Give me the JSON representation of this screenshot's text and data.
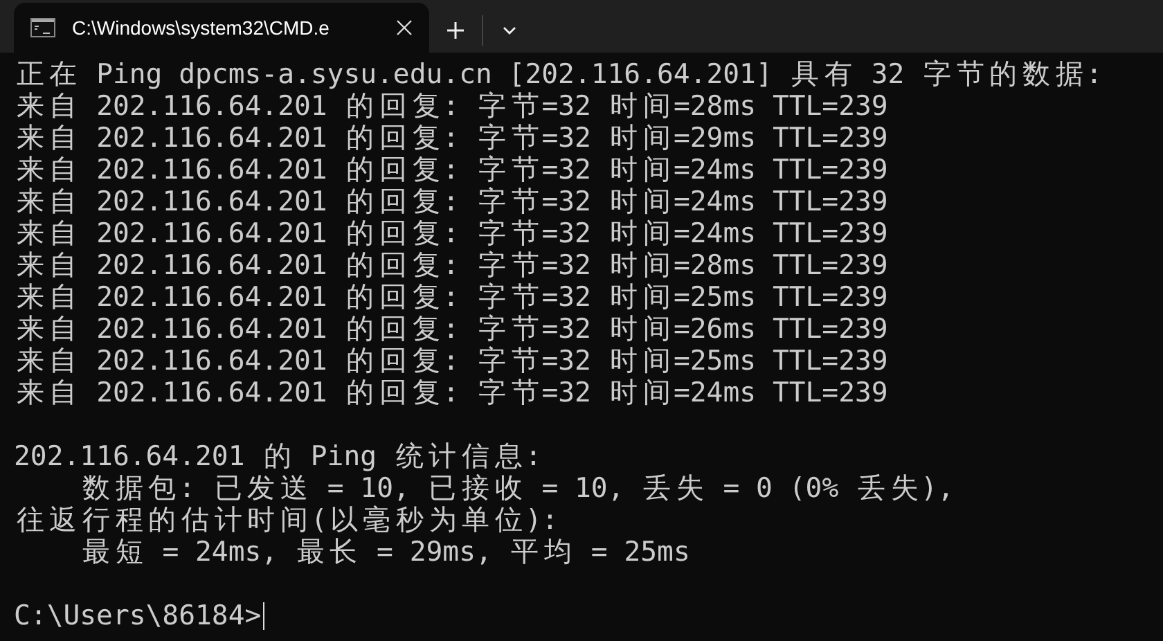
{
  "tab": {
    "title": "C:\\Windows\\system32\\CMD.e",
    "selected": true
  },
  "blocks": [
    [
      "正在 Ping dpcms-a.sysu.edu.cn [202.116.64.201] 具有 32 字节的数据:",
      "来自 202.116.64.201 的回复: 字节=32 时间=28ms TTL=239",
      "来自 202.116.64.201 的回复: 字节=32 时间=29ms TTL=239",
      "来自 202.116.64.201 的回复: 字节=32 时间=24ms TTL=239",
      "来自 202.116.64.201 的回复: 字节=32 时间=24ms TTL=239",
      "来自 202.116.64.201 的回复: 字节=32 时间=24ms TTL=239",
      "来自 202.116.64.201 的回复: 字节=32 时间=28ms TTL=239",
      "来自 202.116.64.201 的回复: 字节=32 时间=25ms TTL=239",
      "来自 202.116.64.201 的回复: 字节=32 时间=26ms TTL=239",
      "来自 202.116.64.201 的回复: 字节=32 时间=25ms TTL=239",
      "来自 202.116.64.201 的回复: 字节=32 时间=24ms TTL=239"
    ],
    [
      "202.116.64.201 的 Ping 统计信息:",
      "    数据包: 已发送 = 10, 已接收 = 10, 丢失 = 0 (0% 丢失),",
      "往返行程的估计时间(以毫秒为单位):",
      "    最短 = 24ms, 最长 = 29ms, 平均 = 25ms"
    ],
    [
      "C:\\Users\\86184>"
    ]
  ]
}
